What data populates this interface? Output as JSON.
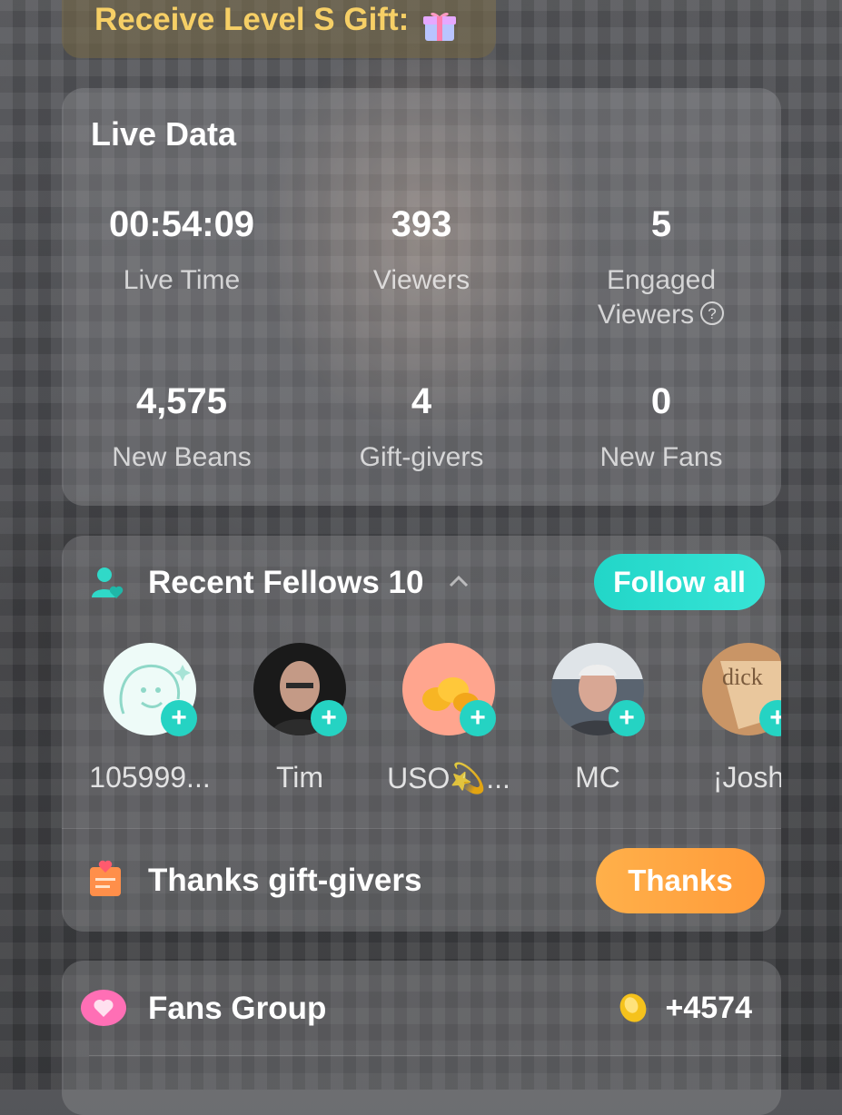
{
  "banner": {
    "text": "Receive Level S Gift:"
  },
  "live_data": {
    "title": "Live Data",
    "stats": [
      {
        "value": "00:54:09",
        "label": "Live Time"
      },
      {
        "value": "393",
        "label": "Viewers"
      },
      {
        "value": "5",
        "label": "Engaged Viewers"
      },
      {
        "value": "4,575",
        "label": "New Beans"
      },
      {
        "value": "4",
        "label": "Gift-givers"
      },
      {
        "value": "0",
        "label": "New Fans"
      }
    ]
  },
  "fellows": {
    "title": "Recent Fellows 10",
    "follow_all": "Follow all",
    "people": [
      {
        "name": "105999..."
      },
      {
        "name": "Tim"
      },
      {
        "name": "USO💫..."
      },
      {
        "name": "MC"
      },
      {
        "name": "¡Josh"
      }
    ],
    "avatar_badge_text": "dick"
  },
  "thanks": {
    "title": "Thanks gift-givers",
    "button": "Thanks"
  },
  "fans_group": {
    "title": "Fans Group",
    "count": "+4574"
  },
  "colors": {
    "accent_teal": "#25d3c3",
    "accent_orange": "#ffa340",
    "gold": "#f6cf66"
  }
}
